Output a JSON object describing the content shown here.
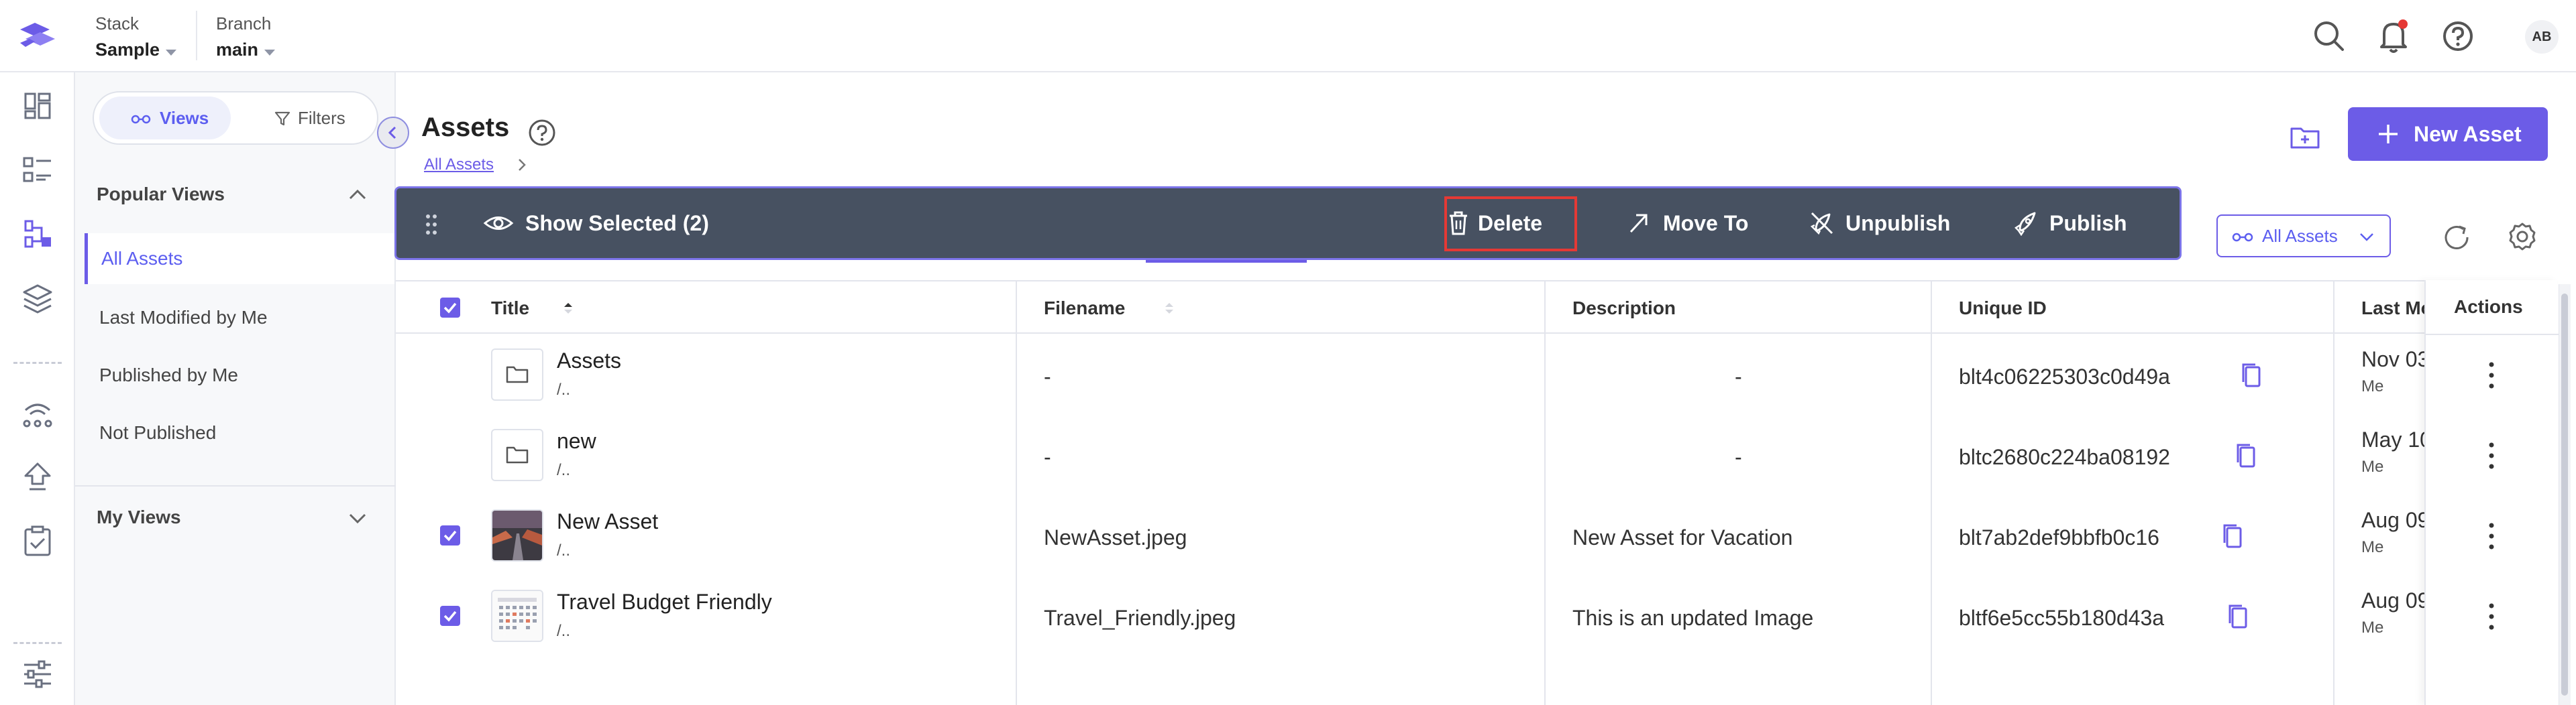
{
  "header": {
    "stack": {
      "label": "Stack",
      "value": "Sample"
    },
    "branch": {
      "label": "Branch",
      "value": "main"
    },
    "avatar_initials": "AB"
  },
  "side_panel": {
    "views_label": "Views",
    "filters_label": "Filters",
    "popular_views_title": "Popular Views",
    "popular_views": [
      "All Assets",
      "Last Modified by Me",
      "Published by Me",
      "Not Published"
    ],
    "active_view": "All Assets",
    "my_views_title": "My Views"
  },
  "main": {
    "page_title": "Assets",
    "breadcrumb": "All Assets",
    "new_asset_label": "New Asset",
    "filter_dropdown": "All Assets"
  },
  "selection_toolbar": {
    "show_selected": "Show Selected (2)",
    "delete": "Delete",
    "move_to": "Move To",
    "unpublish": "Unpublish",
    "publish": "Publish"
  },
  "table": {
    "columns": {
      "title": "Title",
      "filename": "Filename",
      "description": "Description",
      "unique_id": "Unique ID",
      "last_modified": "Last Mo",
      "actions": "Actions"
    },
    "rows": [
      {
        "title": "Assets",
        "path": "/..",
        "filename": "-",
        "description": "-",
        "uid": "blt4c06225303c0d49a",
        "date": "Nov 03",
        "by": "Me"
      },
      {
        "title": "new",
        "path": "/..",
        "filename": "-",
        "description": "-",
        "uid": "bltc2680c224ba08192",
        "date": "May 10",
        "by": "Me"
      },
      {
        "title": "New Asset",
        "path": "/..",
        "filename": "NewAsset.jpeg",
        "description": "New Asset for Vacation",
        "uid": "blt7ab2def9bbfb0c16",
        "date": "Aug 09",
        "by": "Me"
      },
      {
        "title": "Travel Budget Friendly",
        "path": "/..",
        "filename": "Travel_Friendly.jpeg",
        "description": "This is an updated Image",
        "uid": "bltf6e5cc55b180d43a",
        "date": "Aug 09",
        "by": "Me"
      }
    ]
  },
  "colors": {
    "accent": "#6c5ce7",
    "toolbar_bg": "#475161",
    "highlight_border": "#e53935"
  }
}
